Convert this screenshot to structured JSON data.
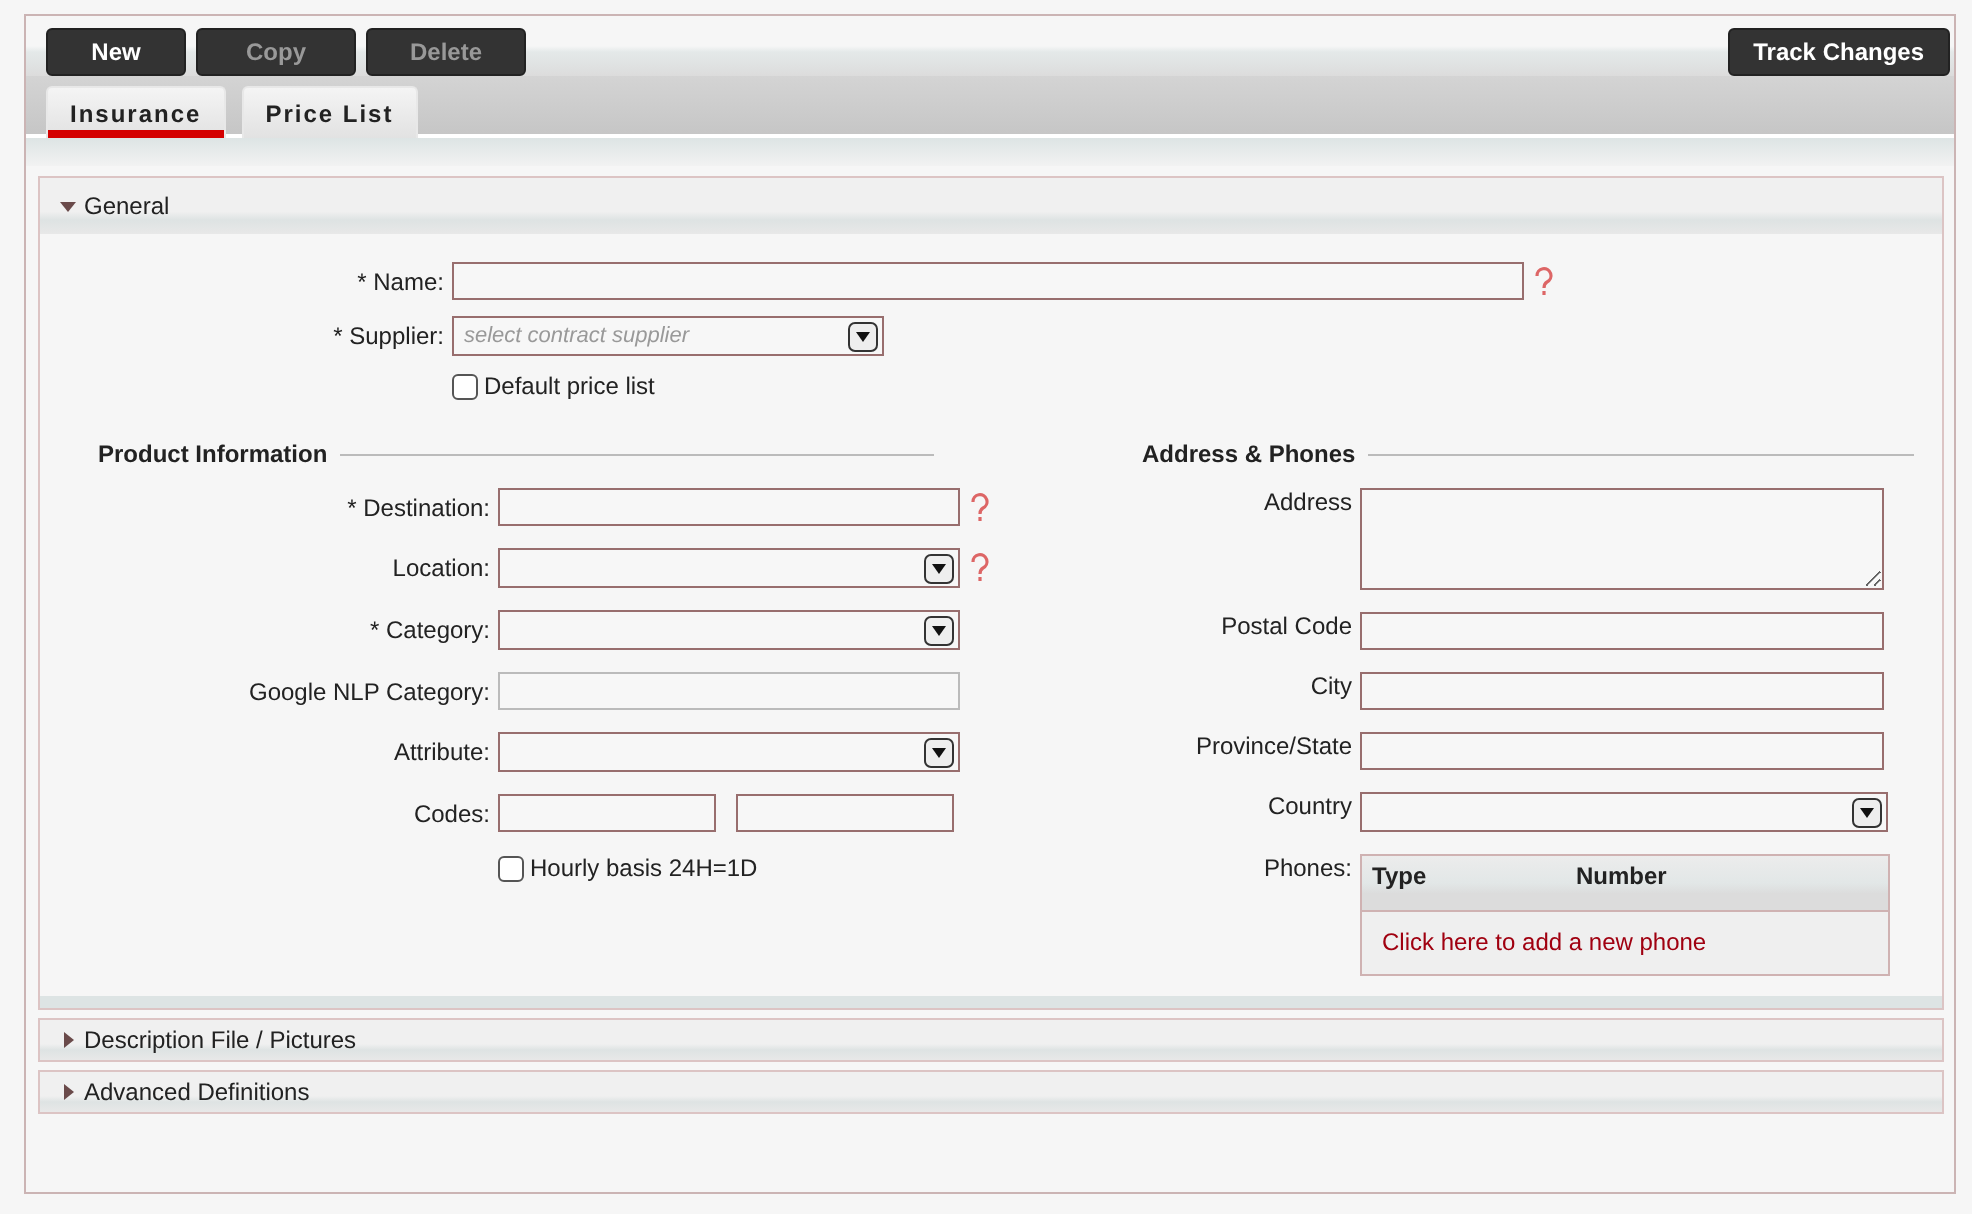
{
  "toolbar": {
    "buttons": [
      {
        "label": "New",
        "disabled": false
      },
      {
        "label": "Copy",
        "disabled": true
      },
      {
        "label": "Delete",
        "disabled": true
      }
    ],
    "track_changes": {
      "label": "Track Changes"
    }
  },
  "tabs": [
    {
      "label": "Insurance",
      "selected": true
    },
    {
      "label": "Price List",
      "selected": false
    }
  ],
  "general": {
    "title": "General",
    "expanded": true,
    "top_fields": [
      {
        "kind": "text",
        "label": "* Name:",
        "help": true
      },
      {
        "kind": "select",
        "label": "* Supplier:",
        "placeholder": "select contract supplier"
      },
      {
        "kind": "checkbox",
        "label": "Default price list",
        "checked": false
      }
    ],
    "product": {
      "title": "Product Information",
      "fields": [
        {
          "kind": "text",
          "label": "* Destination:",
          "help": true
        },
        {
          "kind": "select",
          "label": "Location:",
          "help": true
        },
        {
          "kind": "select",
          "label": "* Category:"
        },
        {
          "kind": "text",
          "label": "Google NLP Category:",
          "disabled": true
        },
        {
          "kind": "select",
          "label": "Attribute:"
        },
        {
          "kind": "pair",
          "label": "Codes:"
        },
        {
          "kind": "checkbox",
          "label": "Hourly basis 24H=1D",
          "checked": false
        }
      ]
    },
    "address": {
      "title": "Address & Phones",
      "fields": [
        {
          "kind": "textarea",
          "label": "Address"
        },
        {
          "kind": "text",
          "label": "Postal Code"
        },
        {
          "kind": "text",
          "label": "City"
        },
        {
          "kind": "text",
          "label": "Province/State"
        },
        {
          "kind": "select",
          "label": "Country"
        }
      ],
      "phones": {
        "label": "Phones:",
        "columns": [
          "Type",
          "Number"
        ],
        "add_link": "Click here to add a new phone"
      }
    }
  },
  "collapsed_sections": [
    {
      "title": "Description File / Pictures",
      "expanded": false
    },
    {
      "title": "Advanced Definitions",
      "expanded": false
    }
  ]
}
